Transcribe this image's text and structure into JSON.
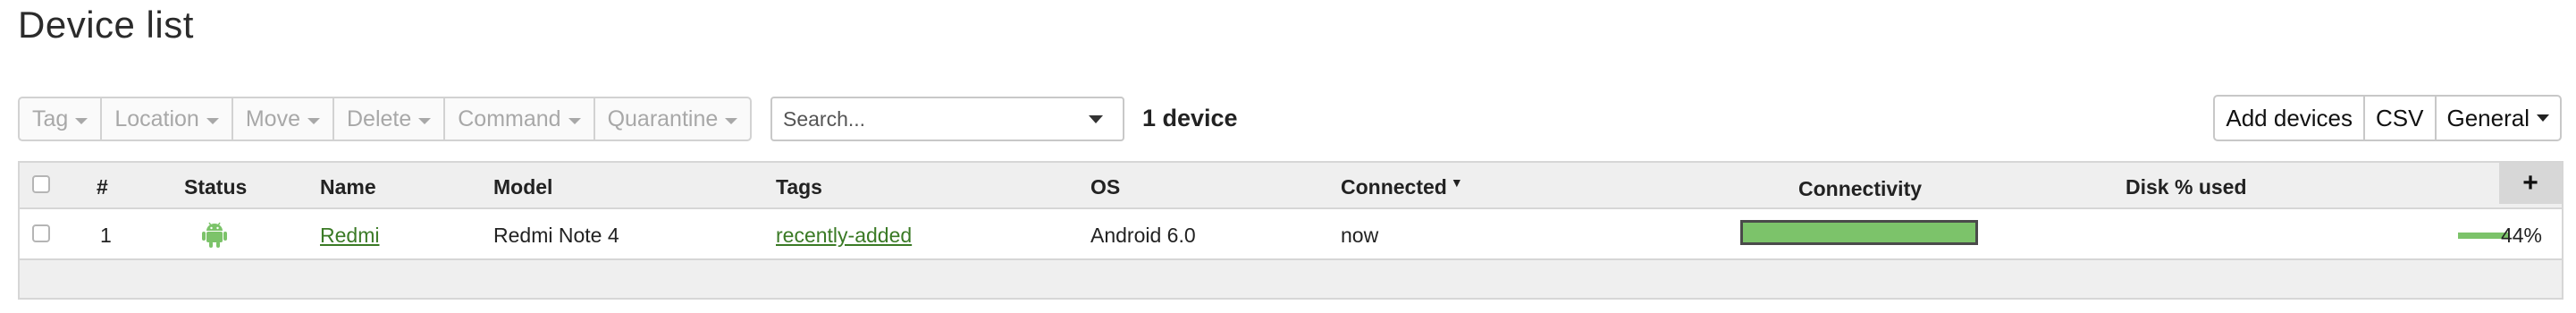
{
  "page": {
    "title": "Device list"
  },
  "toolbar": {
    "buttons": [
      {
        "label": "Tag"
      },
      {
        "label": "Location"
      },
      {
        "label": "Move"
      },
      {
        "label": "Delete"
      },
      {
        "label": "Command"
      },
      {
        "label": "Quarantine"
      }
    ]
  },
  "search": {
    "placeholder": "Search...",
    "value": ""
  },
  "device_count": "1 device",
  "actions": {
    "add_devices": "Add devices",
    "csv": "CSV",
    "view": "General"
  },
  "table": {
    "columns": {
      "number": "#",
      "status": "Status",
      "name": "Name",
      "model": "Model",
      "tags": "Tags",
      "os": "OS",
      "connected": "Connected",
      "connectivity": "Connectivity",
      "disk": "Disk % used",
      "add": "+"
    },
    "rows": [
      {
        "number": "1",
        "status_icon": "android-icon",
        "name": "Redmi",
        "model": "Redmi Note 4",
        "tags": "recently-added",
        "os": "Android 6.0",
        "connected": "now",
        "connectivity_fraction": 1.0,
        "disk_fraction": 0.44,
        "disk_label": "44%"
      }
    ]
  },
  "colors": {
    "accent_green": "#7cc36a",
    "link_green": "#3a7a25"
  }
}
